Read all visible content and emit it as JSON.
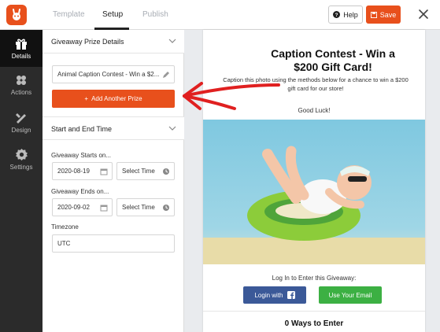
{
  "header": {
    "tabs": [
      {
        "label": "Template"
      },
      {
        "label": "Setup"
      },
      {
        "label": "Publish"
      }
    ],
    "help_label": "Help",
    "save_label": "Save"
  },
  "sidebar": {
    "items": [
      {
        "label": "Details",
        "icon": "gift-icon"
      },
      {
        "label": "Actions",
        "icon": "actions-icon"
      },
      {
        "label": "Design",
        "icon": "design-icon"
      },
      {
        "label": "Settings",
        "icon": "gear-icon"
      }
    ]
  },
  "panel": {
    "prize_section_title": "Giveaway Prize Details",
    "prize_value": "Animal Caption Contest - Win a $2...",
    "add_prize_label": "Add Another Prize",
    "dates_section_title": "Start and End Time",
    "starts_label": "Giveaway Starts on...",
    "start_date": "2020-08-19",
    "start_time_placeholder": "Select Time",
    "ends_label": "Giveaway Ends on...",
    "end_date": "2020-09-02",
    "end_time_placeholder": "Select Time",
    "timezone_label": "Timezone",
    "timezone_value": "UTC"
  },
  "preview": {
    "title": "Caption Contest - Win a $200 Gift Card!",
    "description": "Caption this photo using the methods below for a chance to win a $200 gift card for our store!",
    "good_luck": "Good Luck!",
    "login_prompt": "Log In to Enter this Giveaway:",
    "facebook_label": "Login with",
    "email_label": "Use Your Email",
    "ways_to_enter": "0 Ways to Enter"
  },
  "colors": {
    "brand": "#e8501c",
    "nav_bg": "#2b2b2b",
    "facebook": "#3b5998",
    "email": "#3cb043",
    "annotation_arrow": "#e02020"
  }
}
